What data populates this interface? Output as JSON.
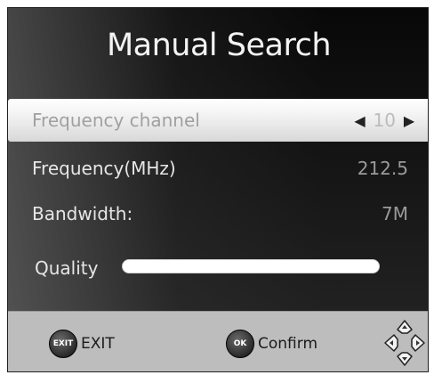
{
  "title": "Manual Search",
  "rows": {
    "frequency_channel": {
      "label": "Frequency channel",
      "value": "10"
    },
    "frequency": {
      "label": "Frequency(MHz)",
      "value": "212.5"
    },
    "bandwidth": {
      "label": "Bandwidth:",
      "value": "7M"
    }
  },
  "quality": {
    "label": "Quality",
    "level_percent": 100
  },
  "footer": {
    "exit": {
      "icon_text": "EXIT",
      "label": "EXIT"
    },
    "ok": {
      "icon_text": "OK",
      "label": "Confirm"
    },
    "dpad_icon": "navigation-dpad-icon"
  },
  "colors": {
    "selected_row": "#f0f0f0",
    "footer_bg": "#bdbdbd",
    "background": "#1a1a1a"
  }
}
